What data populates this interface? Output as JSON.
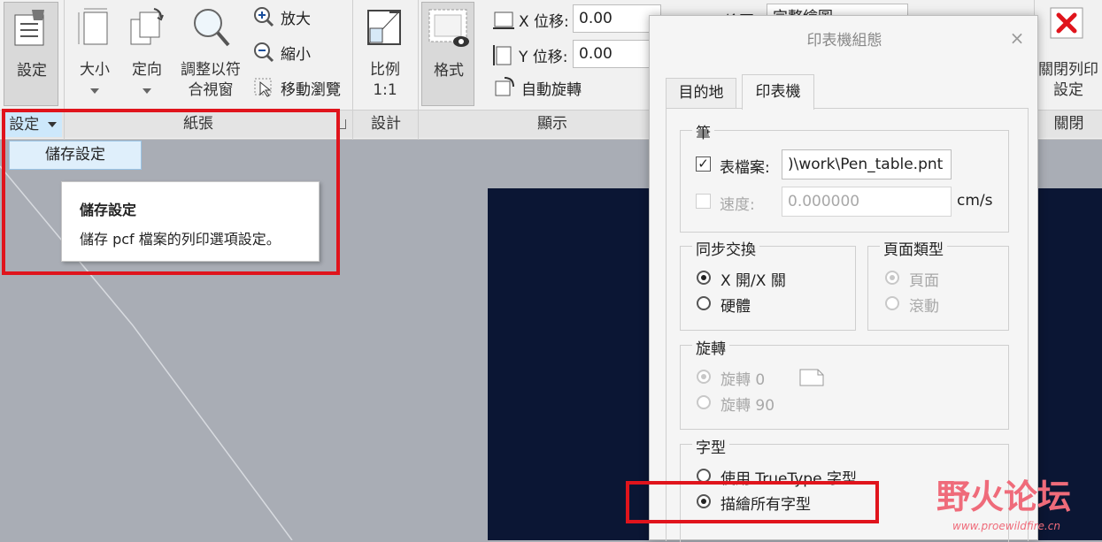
{
  "ribbon": {
    "settings_btn": "設定",
    "size_btn": "大小",
    "orientation_btn": "定向",
    "fit_line1": "調整以符",
    "fit_line2": "合視窗",
    "zoom_in": "放大",
    "zoom_out": "縮小",
    "pan": "移動瀏覽",
    "scale_line1": "比例",
    "scale_line2": "1:1",
    "format_btn": "格式",
    "x_offset_label": "X 位移:",
    "x_offset_value": "0.00",
    "y_offset_label": "Y 位移:",
    "y_offset_value": "0.00",
    "auto_rotate": "自動旋轉",
    "plot_label": "繪圖",
    "plot_select": "完整繪圖",
    "close_line1": "關閉列印",
    "close_line2": "設定",
    "groups": {
      "settings": "設定",
      "paper": "紙張",
      "design": "設計",
      "display": "顯示",
      "close": "關閉"
    }
  },
  "dropdown": {
    "save_settings": "儲存設定"
  },
  "tooltip": {
    "title": "儲存設定",
    "body": "儲存 pcf 檔案的列印選項設定。"
  },
  "dialog": {
    "title": "印表機組態",
    "tabs": [
      "目的地",
      "印表機"
    ],
    "pen_group": "筆",
    "table_file_label": "表檔案:",
    "table_file_value": ")\\work\\Pen_table.pnt",
    "speed_label": "速度:",
    "speed_value": "0.000000",
    "speed_unit": "cm/s",
    "handshake_group": "同步交換",
    "handshake_xonxoff": "X 開/X 關",
    "handshake_hardware": "硬體",
    "pagetype_group": "頁面類型",
    "pagetype_page": "頁面",
    "pagetype_roll": "滾動",
    "rotation_group": "旋轉",
    "rotate_0": "旋轉 0",
    "rotate_90": "旋轉 90",
    "font_group": "字型",
    "font_truetype": "使用 TrueType 字型",
    "font_stroke": "描繪所有字型"
  },
  "watermark": {
    "logo_text": "野火论坛",
    "url": "www.proewildfire.cn"
  },
  "colors": {
    "highlight_red": "#e0141c",
    "sheet_dark": "#0b1634",
    "dropdown_blue": "#dfeffb"
  }
}
